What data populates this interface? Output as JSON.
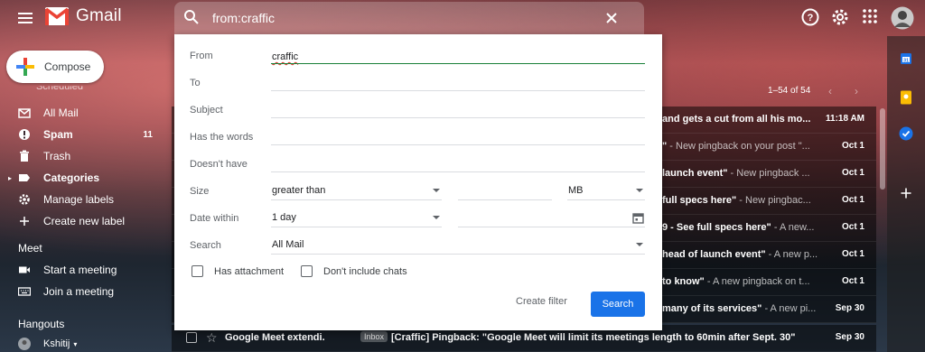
{
  "app": {
    "title": "Gmail"
  },
  "search": {
    "query": "from:craffic"
  },
  "compose": {
    "label": "Compose"
  },
  "nav": {
    "partial_item": "Scheduled",
    "items": [
      {
        "label": "All Mail",
        "icon": "all-mail-icon",
        "bold": false,
        "count": ""
      },
      {
        "label": "Spam",
        "icon": "spam-icon",
        "bold": true,
        "count": "11"
      },
      {
        "label": "Trash",
        "icon": "trash-icon",
        "bold": false,
        "count": ""
      },
      {
        "label": "Categories",
        "icon": "label-icon",
        "bold": true,
        "count": ""
      },
      {
        "label": "Manage labels",
        "icon": "gear-icon",
        "bold": false,
        "count": ""
      },
      {
        "label": "Create new label",
        "icon": "plus-icon",
        "bold": false,
        "count": ""
      }
    ]
  },
  "meet": {
    "title": "Meet",
    "start": "Start a meeting",
    "join": "Join a meeting"
  },
  "hangouts": {
    "title": "Hangouts",
    "user": "Kshitij"
  },
  "pagination": {
    "range": "1–54 of 54"
  },
  "emails": [
    {
      "subject": "and gets a cut from all his mo...",
      "snippet": "",
      "date": "11:18 AM"
    },
    {
      "subject": "\"",
      "snippet": " - New pingback on your post \"...",
      "date": "Oct 1"
    },
    {
      "subject": "launch event\"",
      "snippet": " - New pingback ...",
      "date": "Oct 1"
    },
    {
      "subject": "full specs here\"",
      "snippet": " - New pingbac...",
      "date": "Oct 1"
    },
    {
      "subject": "9 - See full specs here\"",
      "snippet": " - A new...",
      "date": "Oct 1"
    },
    {
      "subject": "head of launch event\"",
      "snippet": " - A new p...",
      "date": "Oct 1"
    },
    {
      "subject": "to know\"",
      "snippet": " - A new pingback on t...",
      "date": "Oct 1"
    },
    {
      "subject": "many of its services\"",
      "snippet": " - A new pi...",
      "date": "Sep 30"
    }
  ],
  "last_email": {
    "sender": "Google Meet extendi.",
    "label": "Inbox",
    "subject": "[Craffic] Pingback: \"Google Meet will limit its meetings length to 60min after Sept. 30\"",
    "date": "Sep 30"
  },
  "advanced_search": {
    "from_label": "From",
    "from_value": "craffic",
    "to_label": "To",
    "subject_label": "Subject",
    "has_words_label": "Has the words",
    "doesnt_have_label": "Doesn't have",
    "size_label": "Size",
    "size_operator": "greater than",
    "size_unit": "MB",
    "date_within_label": "Date within",
    "date_within_value": "1 day",
    "search_label": "Search",
    "search_value": "All Mail",
    "has_attachment": "Has attachment",
    "dont_include_chats": "Don't include chats",
    "create_filter": "Create filter",
    "search_button": "Search"
  },
  "colors": {
    "accent": "#1a73e8",
    "gmail_red": "#ea4335",
    "active_field": "#188038"
  }
}
